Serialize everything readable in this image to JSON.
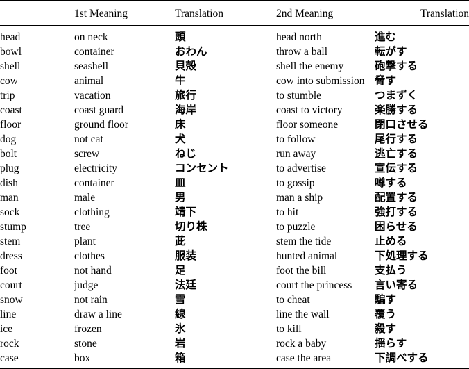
{
  "table": {
    "headers": {
      "word": "",
      "meaning1": "1st Meaning",
      "translation1": "Translation",
      "meaning2": "2nd Meaning",
      "translation2": "Translation"
    },
    "rows": [
      {
        "word": "head",
        "meaning1": "on neck",
        "translation1": "頭",
        "meaning2": "head north",
        "translation2": "進む"
      },
      {
        "word": "bowl",
        "meaning1": "container",
        "translation1": "おわん",
        "meaning2": "throw a ball",
        "translation2": "転がす"
      },
      {
        "word": "shell",
        "meaning1": "seashell",
        "translation1": "貝殻",
        "meaning2": "shell the enemy",
        "translation2": "砲撃する"
      },
      {
        "word": "cow",
        "meaning1": "animal",
        "translation1": "牛",
        "meaning2": "cow into submission",
        "translation2": "脅す"
      },
      {
        "word": "trip",
        "meaning1": "vacation",
        "translation1": "旅行",
        "meaning2": "to stumble",
        "translation2": "つまずく"
      },
      {
        "word": "coast",
        "meaning1": "coast guard",
        "translation1": "海岸",
        "meaning2": "coast to victory",
        "translation2": "楽勝する"
      },
      {
        "word": "floor",
        "meaning1": "ground floor",
        "translation1": "床",
        "meaning2": "floor someone",
        "translation2": "閉口させる"
      },
      {
        "word": "dog",
        "meaning1": "not cat",
        "translation1": "犬",
        "meaning2": "to follow",
        "translation2": "尾行する"
      },
      {
        "word": "bolt",
        "meaning1": "screw",
        "translation1": "ねじ",
        "meaning2": "run away",
        "translation2": "逃亡する"
      },
      {
        "word": "plug",
        "meaning1": "electricity",
        "translation1": "コンセント",
        "meaning2": "to advertise",
        "translation2": "宣伝する"
      },
      {
        "word": "dish",
        "meaning1": "container",
        "translation1": "皿",
        "meaning2": "to gossip",
        "translation2": "噂する"
      },
      {
        "word": "man",
        "meaning1": "male",
        "translation1": "男",
        "meaning2": "man a ship",
        "translation2": "配置する"
      },
      {
        "word": "sock",
        "meaning1": "clothing",
        "translation1": "靖下",
        "meaning2": "to hit",
        "translation2": "強打する"
      },
      {
        "word": "stump",
        "meaning1": "tree",
        "translation1": "切り株",
        "meaning2": "to puzzle",
        "translation2": "困らせる"
      },
      {
        "word": "stem",
        "meaning1": "plant",
        "translation1": "茈",
        "meaning2": "stem the tide",
        "translation2": "止める"
      },
      {
        "word": "dress",
        "meaning1": "clothes",
        "translation1": "服装",
        "meaning2": "hunted animal",
        "translation2": "下処理する"
      },
      {
        "word": "foot",
        "meaning1": "not hand",
        "translation1": "足",
        "meaning2": "foot the bill",
        "translation2": "支払う"
      },
      {
        "word": "court",
        "meaning1": "judge",
        "translation1": "法廷",
        "meaning2": "court the princess",
        "translation2": "言い寄る"
      },
      {
        "word": "snow",
        "meaning1": "not rain",
        "translation1": "雪",
        "meaning2": "to cheat",
        "translation2": "騙す"
      },
      {
        "word": "line",
        "meaning1": "draw a line",
        "translation1": "線",
        "meaning2": "line the wall",
        "translation2": "覆う"
      },
      {
        "word": "ice",
        "meaning1": "frozen",
        "translation1": "氷",
        "meaning2": "to kill",
        "translation2": "殺す"
      },
      {
        "word": "rock",
        "meaning1": "stone",
        "translation1": "岩",
        "meaning2": "rock a baby",
        "translation2": "揺らす"
      },
      {
        "word": "case",
        "meaning1": "box",
        "translation1": "箱",
        "meaning2": "case the area",
        "translation2": "下調べする"
      }
    ]
  }
}
